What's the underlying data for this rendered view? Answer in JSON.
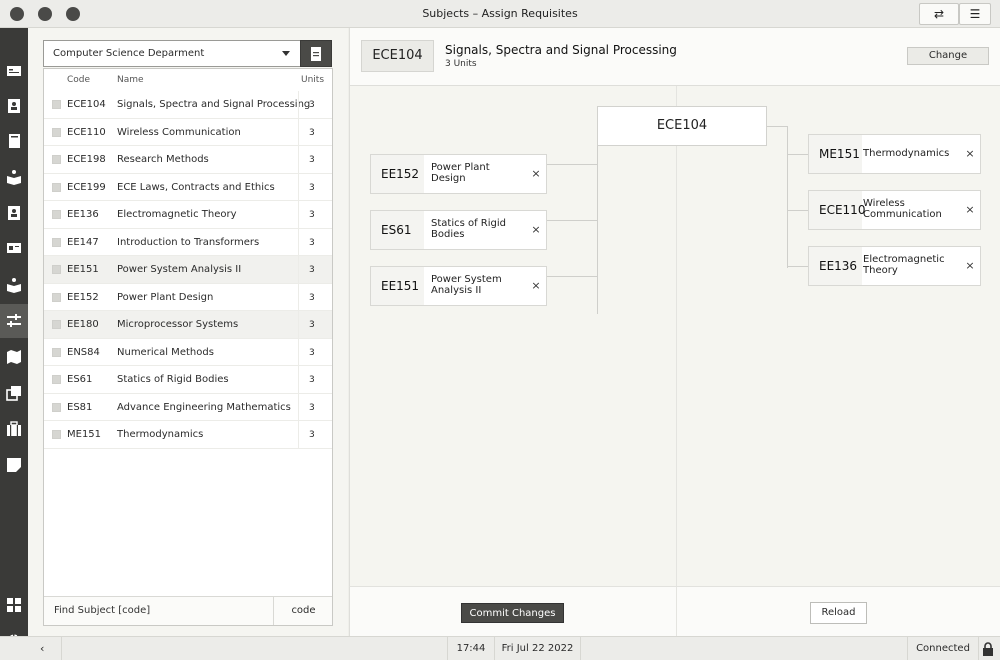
{
  "window": {
    "title": "Subjects – Assign Requisites",
    "swap_icon": "⇄",
    "menu_icon": "☰"
  },
  "left": {
    "department": "Computer Science Deparment",
    "columns": {
      "code": "Code",
      "name": "Name",
      "units": "Units"
    },
    "rows": [
      {
        "code": "ECE104",
        "name": "Signals, Spectra and Signal Processing",
        "units": "3"
      },
      {
        "code": "ECE110",
        "name": "Wireless Communication",
        "units": "3"
      },
      {
        "code": "ECE198",
        "name": "Research Methods",
        "units": "3"
      },
      {
        "code": "ECE199",
        "name": "ECE Laws, Contracts and Ethics",
        "units": "3"
      },
      {
        "code": "EE136",
        "name": "Electromagnetic Theory",
        "units": "3"
      },
      {
        "code": "EE147",
        "name": "Introduction to Transformers",
        "units": "3"
      },
      {
        "code": "EE151",
        "name": "Power System Analysis II",
        "units": "3"
      },
      {
        "code": "EE152",
        "name": "Power Plant Design",
        "units": "3"
      },
      {
        "code": "EE180",
        "name": "Microprocessor Systems",
        "units": "3"
      },
      {
        "code": "ENS84",
        "name": "Numerical Methods",
        "units": "3"
      },
      {
        "code": "ES61",
        "name": "Statics of Rigid Bodies",
        "units": "3"
      },
      {
        "code": "ES81",
        "name": "Advance Engineering Mathematics",
        "units": "3"
      },
      {
        "code": "ME151",
        "name": "Thermodynamics",
        "units": "3"
      }
    ],
    "find_placeholder": "Find Subject [code]",
    "find_mode": "code"
  },
  "header": {
    "code": "ECE104",
    "title": "Signals, Spectra and Signal Processing",
    "units": "3 Units",
    "change_label": "Change"
  },
  "diagram": {
    "center": "ECE104",
    "prerequisites": [
      {
        "code": "EE152",
        "name": "Power Plant Design"
      },
      {
        "code": "ES61",
        "name": "Statics of Rigid Bodies"
      },
      {
        "code": "EE151",
        "name": "Power System Analysis II"
      }
    ],
    "dependents": [
      {
        "code": "ME151",
        "name": "Thermodynamics"
      },
      {
        "code": "ECE110",
        "name": "Wireless Communication"
      },
      {
        "code": "EE136",
        "name": "Electromagnetic Theory"
      }
    ],
    "remove_label": "×"
  },
  "actions": {
    "commit_label": "Commit Changes",
    "reload_label": "Reload"
  },
  "status": {
    "back_icon": "‹",
    "time": "17:44",
    "date": "Fri Jul 22 2022",
    "connection": "Connected"
  }
}
